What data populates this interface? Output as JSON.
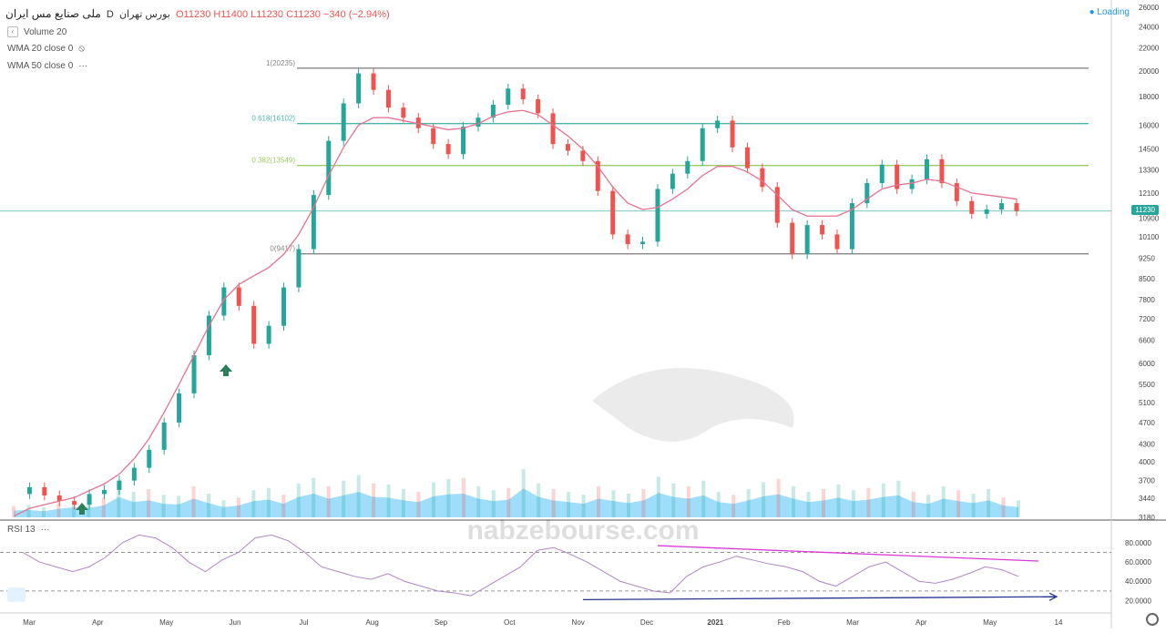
{
  "legend": {
    "title": "ملی صنایع مس ایران",
    "interval": "D",
    "exchange": "بورس تهران",
    "open": "O11230",
    "high": "H11400",
    "low": "L11230",
    "close": "C11230",
    "change": "−340 (−2.94%)"
  },
  "indicators": {
    "volume": "Volume 20",
    "wma20": "WMA 20 close 0",
    "wma50": "WMA 50 close 0",
    "rsi": "RSI 13"
  },
  "status": {
    "loading": "Loading"
  },
  "watermark": {
    "domain": "nabzebourse.com"
  },
  "price_badge": "11230",
  "colors": {
    "up": "#26a69a",
    "down": "#ef5350",
    "wma": "#e57390",
    "rsi": "#b186c6",
    "fib1": "#888888",
    "fib0618": "#4db6ac",
    "fib0382": "#9ccc65",
    "volume_area": "#4fc3f7"
  },
  "chart_data": {
    "type": "candlestick",
    "x_ticks": [
      "Mar",
      "Apr",
      "May",
      "Jun",
      "Jul",
      "Aug",
      "Sep",
      "Oct",
      "Nov",
      "Dec",
      "2021",
      "Feb",
      "Mar",
      "Apr",
      "May",
      "14"
    ],
    "price_ticks": [
      "26000",
      "24000",
      "22000",
      "20000",
      "18000",
      "16000",
      "14500",
      "13300",
      "12100",
      "10900",
      "10100",
      "9250",
      "8500",
      "7800",
      "7200",
      "6600",
      "6000",
      "5500",
      "5100",
      "4700",
      "4300",
      "4000",
      "3700",
      "3440",
      "3180"
    ],
    "rsi_ticks": [
      "80.0000",
      "60.0000",
      "40.0000",
      "20.0000"
    ],
    "fib_levels": [
      {
        "label": "1(20235)",
        "value": 20235
      },
      {
        "label": "0.618(16102)",
        "value": 16102
      },
      {
        "label": "0.382(13549)",
        "value": 13549
      },
      {
        "label": "0(9417)",
        "value": 9417
      }
    ],
    "last_close": 11230,
    "price_series": [
      3500,
      3600,
      3480,
      3400,
      3350,
      3500,
      3560,
      3700,
      3900,
      4200,
      4700,
      5300,
      6200,
      7300,
      8200,
      7600,
      6500,
      7000,
      8200,
      9600,
      12000,
      15000,
      17500,
      19800,
      18500,
      17200,
      16500,
      15800,
      14800,
      14200,
      15900,
      16500,
      17400,
      18600,
      17800,
      16800,
      14800,
      14400,
      13800,
      12200,
      10200,
      9800,
      9900,
      12300,
      13100,
      13800,
      15800,
      16300,
      14600,
      13400,
      12400,
      10700,
      9400,
      10600,
      10200,
      9600,
      11600,
      12600,
      13600,
      12300,
      12800,
      13900,
      12600,
      11700,
      11100,
      11300,
      11600,
      11230
    ],
    "wma_series": [
      3200,
      3300,
      3350,
      3400,
      3450,
      3550,
      3650,
      3800,
      4050,
      4400,
      4900,
      5500,
      6200,
      7000,
      7800,
      8300,
      8600,
      8900,
      9400,
      10200,
      11400,
      13000,
      14600,
      16000,
      16500,
      16500,
      16300,
      16100,
      15900,
      15700,
      15800,
      16100,
      16600,
      16900,
      17000,
      16700,
      16000,
      15300,
      14500,
      13500,
      12400,
      11600,
      11300,
      11400,
      11800,
      12300,
      13000,
      13500,
      13500,
      13200,
      12700,
      12000,
      11300,
      11000,
      11000,
      11000,
      11300,
      11800,
      12300,
      12500,
      12600,
      12800,
      12700,
      12400,
      12100,
      12000,
      11900,
      11800
    ],
    "volume_series": [
      20,
      22,
      18,
      25,
      30,
      28,
      35,
      60,
      45,
      50,
      40,
      38,
      55,
      42,
      30,
      35,
      48,
      52,
      40,
      60,
      70,
      55,
      65,
      75,
      60,
      58,
      50,
      45,
      62,
      68,
      70,
      55,
      48,
      52,
      85,
      60,
      50,
      45,
      40,
      55,
      48,
      42,
      50,
      72,
      60,
      55,
      65,
      45,
      40,
      50,
      62,
      68,
      55,
      45,
      50,
      58,
      48,
      52,
      60,
      65,
      45,
      40,
      55,
      48,
      42,
      50,
      35,
      30
    ],
    "rsi_series": [
      70,
      60,
      55,
      50,
      55,
      65,
      80,
      88,
      85,
      75,
      60,
      50,
      62,
      70,
      85,
      88,
      82,
      70,
      55,
      50,
      45,
      42,
      48,
      40,
      35,
      30,
      28,
      25,
      35,
      45,
      55,
      72,
      75,
      68,
      60,
      50,
      40,
      35,
      30,
      28,
      45,
      55,
      60,
      66,
      62,
      58,
      55,
      50,
      40,
      35,
      45,
      55,
      60,
      50,
      40,
      38,
      42,
      48,
      55,
      52,
      45
    ],
    "rsi_divergence_down": "60-80",
    "rsi_divergence_up": "20-30"
  }
}
